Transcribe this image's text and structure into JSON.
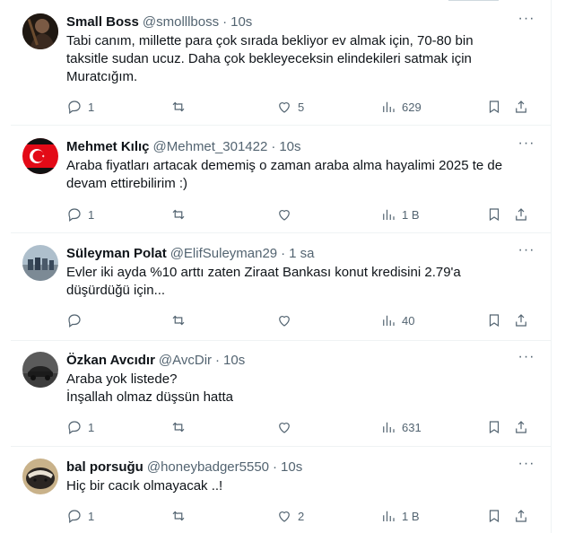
{
  "tweets": [
    {
      "name": "Small Boss",
      "handle": "@smolllboss",
      "time": "10s",
      "text": "Tabi canım, millette para çok sırada bekliyor ev almak için, 70-80 bin\ntaksitle sudan ucuz.  Daha çok bekleyeceksin elindekileri satmak için\nMuratcığım.",
      "replies": "1",
      "retweets": "",
      "likes": "5",
      "views": "629",
      "avatar": "dark-portrait"
    },
    {
      "name": "Mehmet Kılıç",
      "handle": "@Mehmet_301422",
      "time": "10s",
      "text": "Araba fiyatları artacak dememiş o zaman araba alma hayalimi 2025 te de\ndevam ettirebilirim :)",
      "replies": "1",
      "retweets": "",
      "likes": "",
      "views": "1 B",
      "avatar": "turkish-flag"
    },
    {
      "name": "Süleyman Polat",
      "handle": "@ElifSuleyman29",
      "time": "1 sa",
      "text": "Evler iki ayda %10 arttı zaten Ziraat Bankası konut kredisini 2.79'a\ndüşürdüğü için...",
      "replies": "",
      "retweets": "",
      "likes": "",
      "views": "40",
      "avatar": "group-photo"
    },
    {
      "name": "Özkan Avcıdır",
      "handle": "@AvcDir",
      "time": "10s",
      "text": "Araba yok listede?\nİnşallah olmaz düşsün hatta",
      "replies": "1",
      "retweets": "",
      "likes": "",
      "views": "631",
      "avatar": "car-photo"
    },
    {
      "name": "bal porsuğu",
      "handle": "@honeybadger5550",
      "time": "10s",
      "text": "Hiç bir cacık olmayacak ..!",
      "replies": "1",
      "retweets": "",
      "likes": "2",
      "views": "1 B",
      "avatar": "honey-badger"
    }
  ],
  "colors": {
    "text": "#0f1419",
    "muted": "#536471",
    "divider": "#eff3f4",
    "flag_red": "#e30a17"
  }
}
